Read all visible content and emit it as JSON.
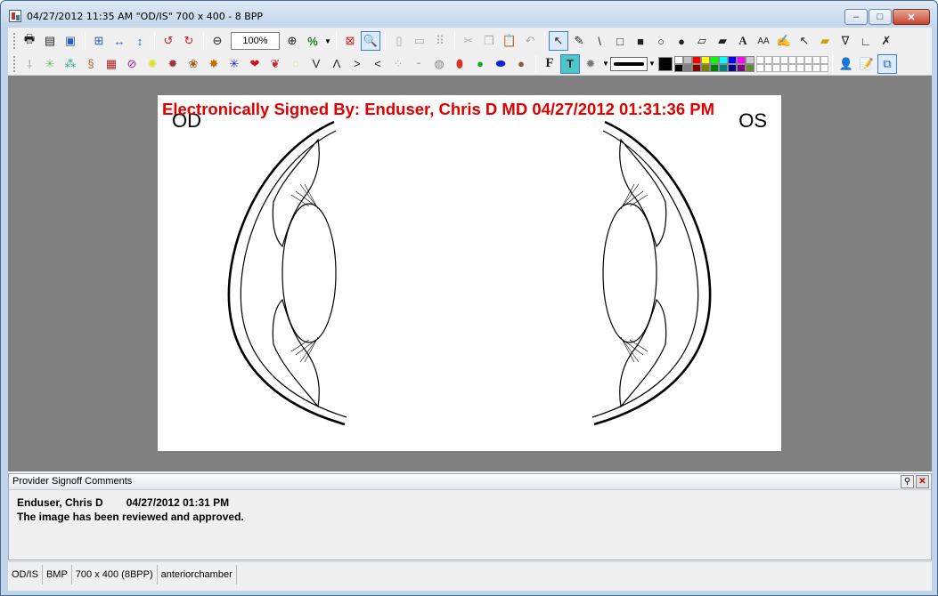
{
  "window": {
    "title": "04/27/2012 11:35 AM \"OD/IS\" 700 x 400 - 8 BPP",
    "minimize": "‒",
    "maximize": "□",
    "close": "✕"
  },
  "toolbar": {
    "zoom_value": "100%",
    "percent_label": "%",
    "font_button": "F",
    "text_button": "T",
    "line_tool": "\\",
    "text_tool": "A",
    "text_size_tool": "AA",
    "symbols": [
      "V",
      "Λ",
      ">",
      "<"
    ]
  },
  "image": {
    "signature": "Electronically Signed By: Enduser, Chris D MD 04/27/2012 01:31:36 PM",
    "label_left": "OD",
    "label_right": "OS"
  },
  "comments": {
    "header": "Provider Signoff Comments",
    "author": "Enduser, Chris D",
    "date": "04/27/2012 01:31 PM",
    "text": "The image has been reviewed and approved."
  },
  "status": {
    "type": "OD/IS",
    "format": "BMP",
    "size": "700 x 400 (8BPP)",
    "category": "anteriorchamber"
  },
  "colors": {
    "signature": "#e00000",
    "canvas_bg": "#808080",
    "titlebar": "#c3d6ec"
  }
}
